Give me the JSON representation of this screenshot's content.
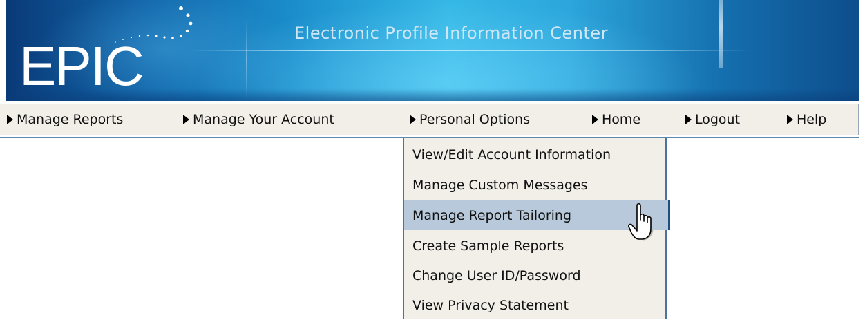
{
  "banner": {
    "logo": "EPIC",
    "tagline": "Electronic Profile Information Center"
  },
  "nav": {
    "items": [
      {
        "label": "Manage Reports",
        "icon": "triangle-right-icon"
      },
      {
        "label": "Manage Your Account",
        "icon": "triangle-right-icon"
      },
      {
        "label": "Personal Options",
        "icon": "triangle-right-icon"
      },
      {
        "label": "Home",
        "icon": "triangle-right-icon"
      },
      {
        "label": "Logout",
        "icon": "triangle-right-icon"
      },
      {
        "label": "Help",
        "icon": "triangle-right-icon"
      }
    ]
  },
  "dropdown": {
    "parent": "Personal Options",
    "hovered": "Manage Report Tailoring",
    "items": [
      {
        "label": "View/Edit Account Information"
      },
      {
        "label": "Manage Custom Messages"
      },
      {
        "label": "Manage Report Tailoring"
      },
      {
        "label": "Create Sample Reports"
      },
      {
        "label": "Change User ID/Password"
      },
      {
        "label": "View Privacy Statement"
      }
    ]
  },
  "cursor": {
    "icon": "hand-pointer-icon"
  },
  "colors": {
    "banner_dark": "#0a3a78",
    "banner_light": "#35b8e6",
    "nav_background": "#f2efe9",
    "nav_border": "#5f87a8",
    "menu_hover": "#b7c9da",
    "menu_border": "#4a74a0"
  }
}
